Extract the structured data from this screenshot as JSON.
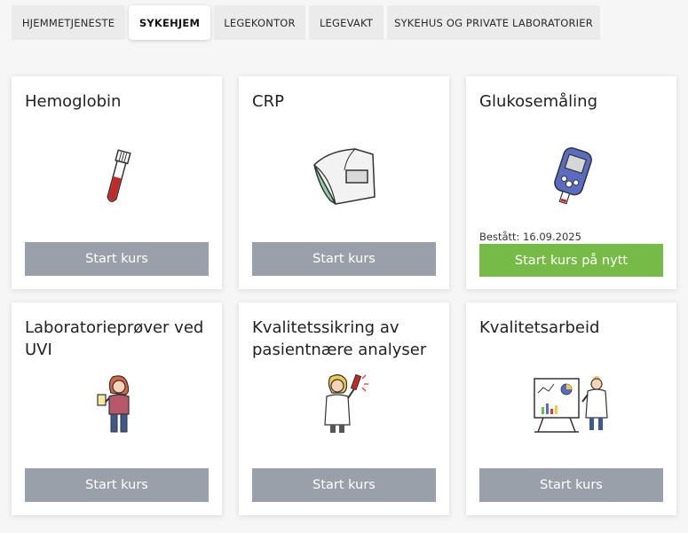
{
  "tabs": [
    {
      "label": "HJEMMETJENESTE",
      "active": false
    },
    {
      "label": "SYKEHJEM",
      "active": true
    },
    {
      "label": "LEGEKONTOR",
      "active": false
    },
    {
      "label": "LEGEVAKT",
      "active": false
    },
    {
      "label": "SYKEHUS OG PRIVATE LABORATORIER",
      "active": false
    }
  ],
  "courses": [
    {
      "title": "Hemoglobin",
      "button": "Start kurs",
      "icon": "blood-tube-icon"
    },
    {
      "title": "CRP",
      "button": "Start kurs",
      "icon": "crp-analyzer-icon"
    },
    {
      "title": "Glukosemåling",
      "button": "Start kurs på nytt",
      "passed": "Bestått: 16.09.2025",
      "icon": "glucose-meter-icon"
    },
    {
      "title": "Laboratorieprøver ved UVI",
      "button": "Start kurs",
      "icon": "urine-sample-person-icon"
    },
    {
      "title": "Kvalitetssikring av pasientnære analyser",
      "button": "Start kurs",
      "icon": "lab-worker-test-tube-icon"
    },
    {
      "title": "Kvalitetsarbeid",
      "button": "Start kurs",
      "icon": "whiteboard-presenter-icon"
    }
  ],
  "colors": {
    "button_gray": "#9aa0a9",
    "button_green": "#76ba47",
    "background": "#f6f6f6"
  }
}
